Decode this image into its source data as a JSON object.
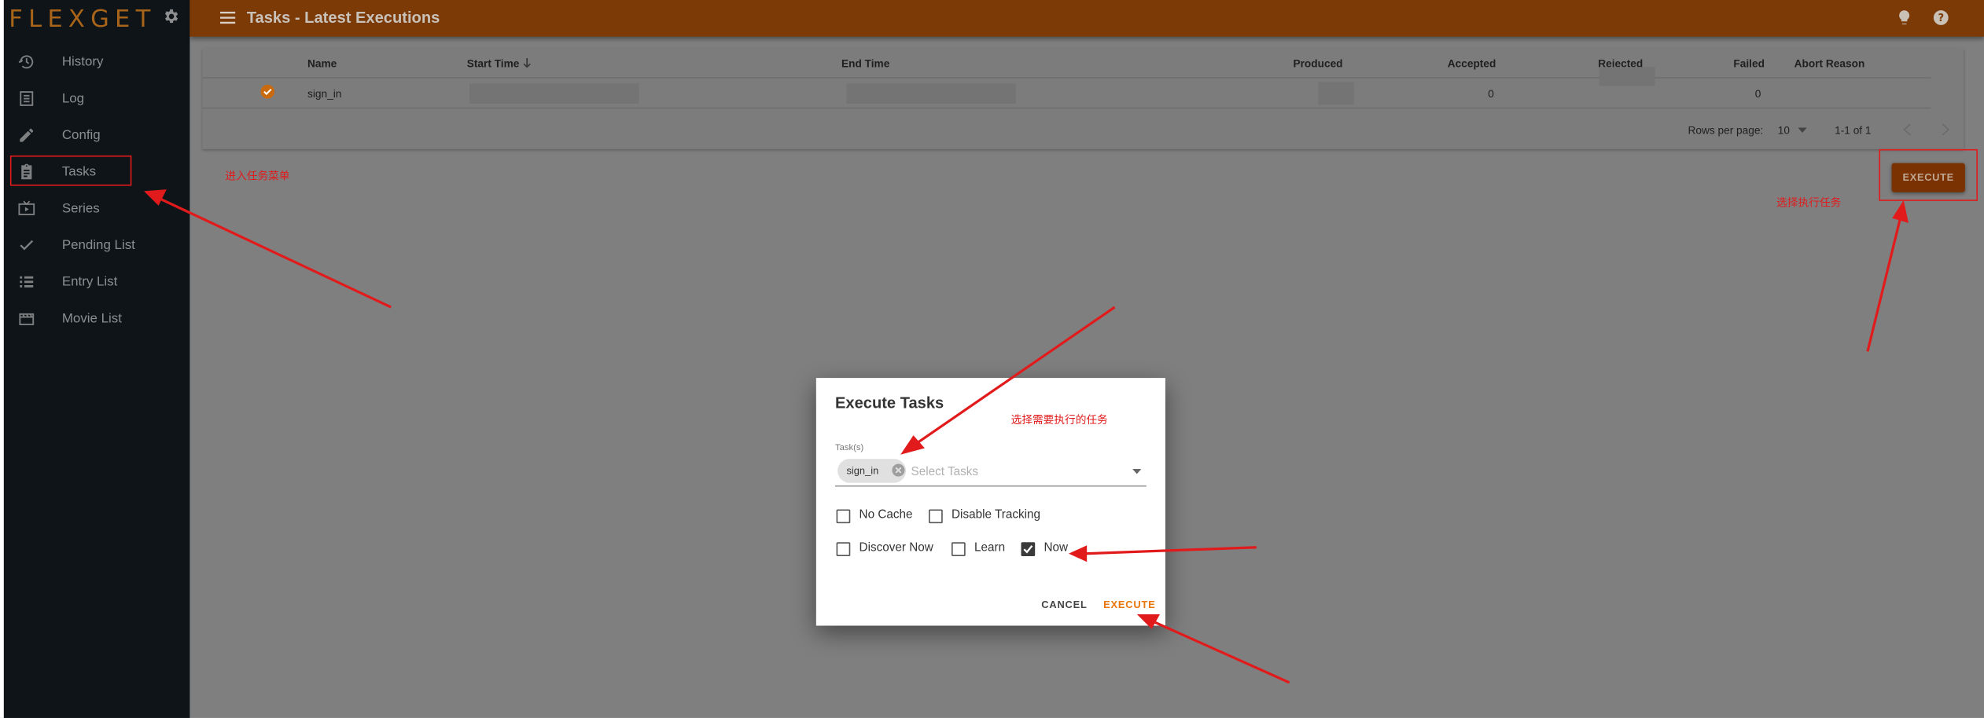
{
  "app": {
    "logo": "FLEXGET",
    "title": "Tasks - Latest Executions"
  },
  "sidebar": {
    "items": [
      {
        "label": "History",
        "icon": "history-icon"
      },
      {
        "label": "Log",
        "icon": "log-icon"
      },
      {
        "label": "Config",
        "icon": "pencil-icon"
      },
      {
        "label": "Tasks",
        "icon": "clipboard-icon"
      },
      {
        "label": "Series",
        "icon": "tv-icon"
      },
      {
        "label": "Pending List",
        "icon": "check-icon"
      },
      {
        "label": "Entry List",
        "icon": "list-icon"
      },
      {
        "label": "Movie List",
        "icon": "movie-icon"
      }
    ]
  },
  "table": {
    "headers": {
      "name": "Name",
      "start_time": "Start Time",
      "end_time": "End Time",
      "produced": "Produced",
      "accepted": "Accepted",
      "rejected": "Rejected",
      "failed": "Failed",
      "abort_reason": "Abort Reason"
    },
    "rows": [
      {
        "name": "sign_in",
        "accepted": "0",
        "failed": "0"
      }
    ],
    "footer": {
      "rows_per_page_label": "Rows per page:",
      "rows_per_page": "10",
      "range": "1-1 of 1"
    }
  },
  "execute_button": "EXECUTE",
  "annotations": {
    "tasks_menu": "进入任务菜单",
    "choose_execute": "选择执行任务",
    "choose_tasks": "选择需要执行的任务"
  },
  "dialog": {
    "title": "Execute Tasks",
    "field_label": "Task(s)",
    "selected_task": "sign_in",
    "placeholder": "Select Tasks",
    "options": [
      {
        "label": "No Cache",
        "checked": false
      },
      {
        "label": "Disable Tracking",
        "checked": false
      },
      {
        "label": "Discover Now",
        "checked": false
      },
      {
        "label": "Learn",
        "checked": false
      },
      {
        "label": "Now",
        "checked": true
      }
    ],
    "cancel": "CANCEL",
    "execute": "EXECUTE"
  },
  "colors": {
    "header": "#7c3a06",
    "accent": "#e8760c",
    "annotation": "#e11b1b",
    "sidebar": "#0e1418"
  }
}
